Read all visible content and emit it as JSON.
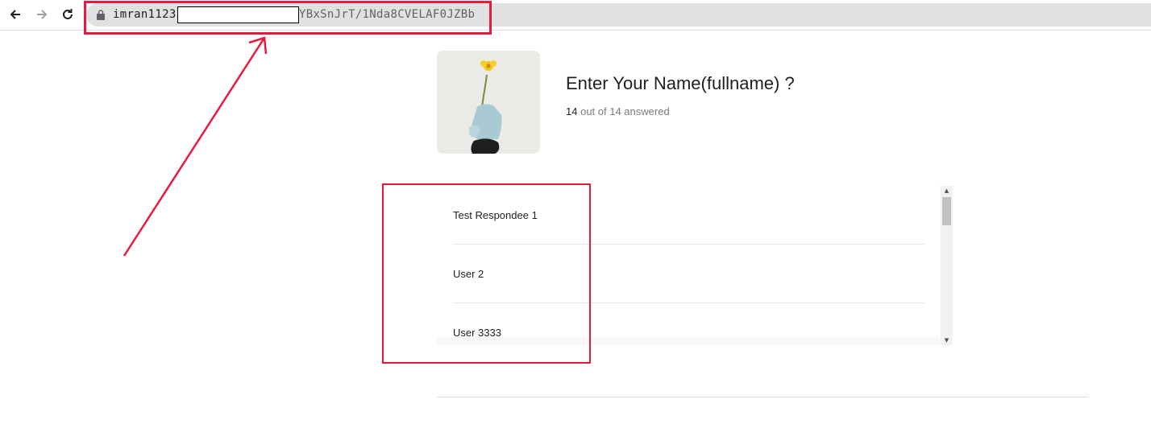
{
  "browser": {
    "url_prefix": "imran1123",
    "url_suffix": "YBxSnJrT/1Nda8CVELAF0JZBb"
  },
  "question": {
    "title": "Enter Your Name(fullname) ?",
    "answered_count": "14",
    "answered_text": "out of 14 answered"
  },
  "responses": [
    "Test Respondee 1",
    "User 2",
    "User 3333"
  ],
  "colors": {
    "annotation": "#e8193c"
  }
}
